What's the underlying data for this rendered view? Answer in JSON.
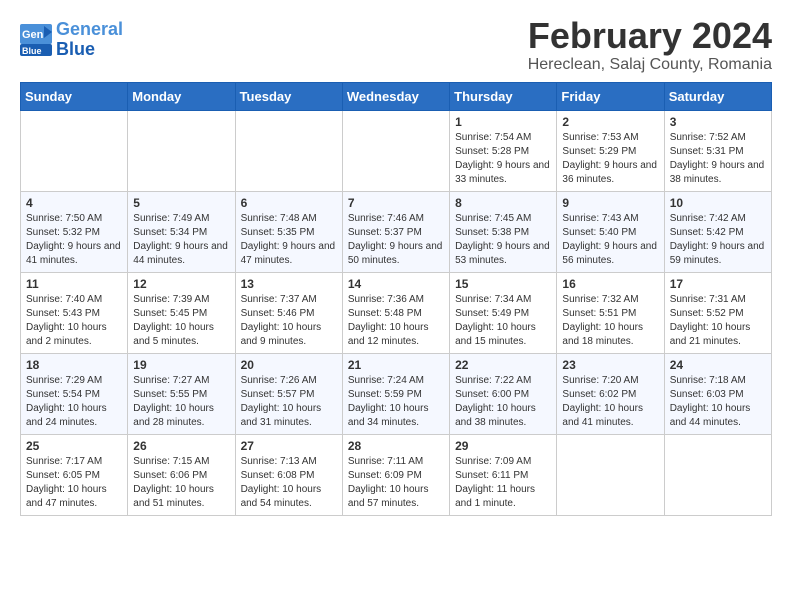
{
  "header": {
    "logo_line1": "General",
    "logo_line2": "Blue",
    "month_year": "February 2024",
    "location": "Hereclean, Salaj County, Romania"
  },
  "weekdays": [
    "Sunday",
    "Monday",
    "Tuesday",
    "Wednesday",
    "Thursday",
    "Friday",
    "Saturday"
  ],
  "weeks": [
    [
      {
        "day": "",
        "info": ""
      },
      {
        "day": "",
        "info": ""
      },
      {
        "day": "",
        "info": ""
      },
      {
        "day": "",
        "info": ""
      },
      {
        "day": "1",
        "info": "Sunrise: 7:54 AM\nSunset: 5:28 PM\nDaylight: 9 hours and 33 minutes."
      },
      {
        "day": "2",
        "info": "Sunrise: 7:53 AM\nSunset: 5:29 PM\nDaylight: 9 hours and 36 minutes."
      },
      {
        "day": "3",
        "info": "Sunrise: 7:52 AM\nSunset: 5:31 PM\nDaylight: 9 hours and 38 minutes."
      }
    ],
    [
      {
        "day": "4",
        "info": "Sunrise: 7:50 AM\nSunset: 5:32 PM\nDaylight: 9 hours and 41 minutes."
      },
      {
        "day": "5",
        "info": "Sunrise: 7:49 AM\nSunset: 5:34 PM\nDaylight: 9 hours and 44 minutes."
      },
      {
        "day": "6",
        "info": "Sunrise: 7:48 AM\nSunset: 5:35 PM\nDaylight: 9 hours and 47 minutes."
      },
      {
        "day": "7",
        "info": "Sunrise: 7:46 AM\nSunset: 5:37 PM\nDaylight: 9 hours and 50 minutes."
      },
      {
        "day": "8",
        "info": "Sunrise: 7:45 AM\nSunset: 5:38 PM\nDaylight: 9 hours and 53 minutes."
      },
      {
        "day": "9",
        "info": "Sunrise: 7:43 AM\nSunset: 5:40 PM\nDaylight: 9 hours and 56 minutes."
      },
      {
        "day": "10",
        "info": "Sunrise: 7:42 AM\nSunset: 5:42 PM\nDaylight: 9 hours and 59 minutes."
      }
    ],
    [
      {
        "day": "11",
        "info": "Sunrise: 7:40 AM\nSunset: 5:43 PM\nDaylight: 10 hours and 2 minutes."
      },
      {
        "day": "12",
        "info": "Sunrise: 7:39 AM\nSunset: 5:45 PM\nDaylight: 10 hours and 5 minutes."
      },
      {
        "day": "13",
        "info": "Sunrise: 7:37 AM\nSunset: 5:46 PM\nDaylight: 10 hours and 9 minutes."
      },
      {
        "day": "14",
        "info": "Sunrise: 7:36 AM\nSunset: 5:48 PM\nDaylight: 10 hours and 12 minutes."
      },
      {
        "day": "15",
        "info": "Sunrise: 7:34 AM\nSunset: 5:49 PM\nDaylight: 10 hours and 15 minutes."
      },
      {
        "day": "16",
        "info": "Sunrise: 7:32 AM\nSunset: 5:51 PM\nDaylight: 10 hours and 18 minutes."
      },
      {
        "day": "17",
        "info": "Sunrise: 7:31 AM\nSunset: 5:52 PM\nDaylight: 10 hours and 21 minutes."
      }
    ],
    [
      {
        "day": "18",
        "info": "Sunrise: 7:29 AM\nSunset: 5:54 PM\nDaylight: 10 hours and 24 minutes."
      },
      {
        "day": "19",
        "info": "Sunrise: 7:27 AM\nSunset: 5:55 PM\nDaylight: 10 hours and 28 minutes."
      },
      {
        "day": "20",
        "info": "Sunrise: 7:26 AM\nSunset: 5:57 PM\nDaylight: 10 hours and 31 minutes."
      },
      {
        "day": "21",
        "info": "Sunrise: 7:24 AM\nSunset: 5:59 PM\nDaylight: 10 hours and 34 minutes."
      },
      {
        "day": "22",
        "info": "Sunrise: 7:22 AM\nSunset: 6:00 PM\nDaylight: 10 hours and 38 minutes."
      },
      {
        "day": "23",
        "info": "Sunrise: 7:20 AM\nSunset: 6:02 PM\nDaylight: 10 hours and 41 minutes."
      },
      {
        "day": "24",
        "info": "Sunrise: 7:18 AM\nSunset: 6:03 PM\nDaylight: 10 hours and 44 minutes."
      }
    ],
    [
      {
        "day": "25",
        "info": "Sunrise: 7:17 AM\nSunset: 6:05 PM\nDaylight: 10 hours and 47 minutes."
      },
      {
        "day": "26",
        "info": "Sunrise: 7:15 AM\nSunset: 6:06 PM\nDaylight: 10 hours and 51 minutes."
      },
      {
        "day": "27",
        "info": "Sunrise: 7:13 AM\nSunset: 6:08 PM\nDaylight: 10 hours and 54 minutes."
      },
      {
        "day": "28",
        "info": "Sunrise: 7:11 AM\nSunset: 6:09 PM\nDaylight: 10 hours and 57 minutes."
      },
      {
        "day": "29",
        "info": "Sunrise: 7:09 AM\nSunset: 6:11 PM\nDaylight: 11 hours and 1 minute."
      },
      {
        "day": "",
        "info": ""
      },
      {
        "day": "",
        "info": ""
      }
    ]
  ]
}
